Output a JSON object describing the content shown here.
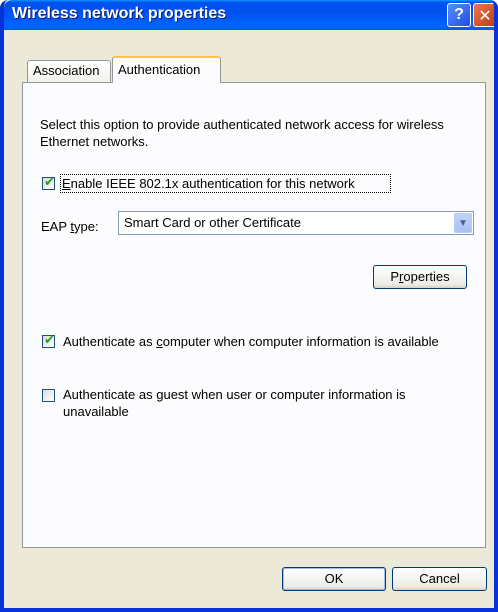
{
  "window": {
    "title": "Wireless network properties",
    "help_glyph": "?",
    "close_glyph": "✕"
  },
  "tabs": [
    {
      "label": "Association",
      "selected": false
    },
    {
      "label": "Authentication",
      "selected": true
    }
  ],
  "auth": {
    "description": "Select this option to provide authenticated network access for wireless Ethernet networks.",
    "enable_8021x": {
      "label_pre": "",
      "label_u": "E",
      "label_post": "nable IEEE 802.1x authentication for this network",
      "checked": true
    },
    "eap_type": {
      "label_pre": "EAP ",
      "label_u": "t",
      "label_post": "ype:",
      "value": "Smart Card or other Certificate"
    },
    "properties_button": {
      "pre": "P",
      "u": "r",
      "post": "operties"
    },
    "auth_computer": {
      "label_pre": "Authenticate as ",
      "label_u": "c",
      "label_post": "omputer when computer information is available",
      "checked": true
    },
    "auth_guest": {
      "label_pre": "Authenticate as ",
      "label_u": "g",
      "label_post": "uest when user or computer information is",
      "label_line2": "unavailable",
      "checked": false
    }
  },
  "footer": {
    "ok": "OK",
    "cancel": "Cancel"
  },
  "colors": {
    "title_bar": "#0058ee",
    "dialog_bg": "#ece9d8",
    "panel_bg": "#fcfcfe",
    "checkmark": "#21a121"
  }
}
